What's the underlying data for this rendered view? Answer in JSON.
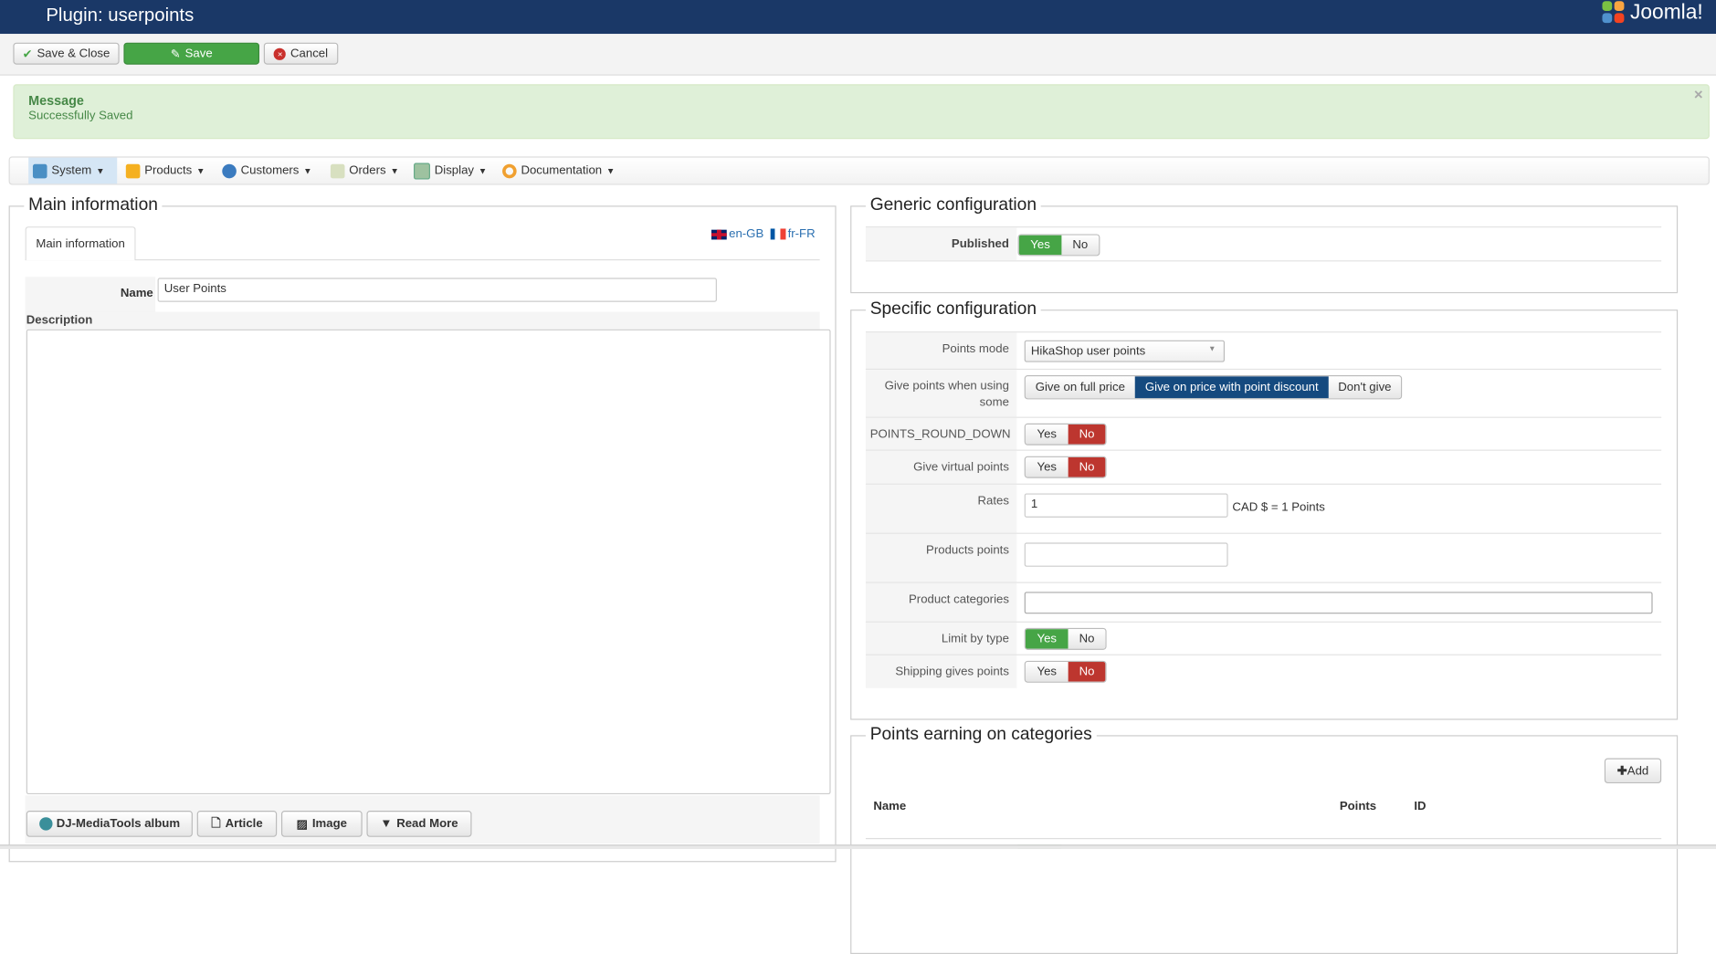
{
  "header": {
    "title": "Plugin: userpoints",
    "logo_text": "Joomla!"
  },
  "toolbar": {
    "save_close": "Save & Close",
    "save": "Save",
    "cancel": "Cancel"
  },
  "message": {
    "heading": "Message",
    "text": "Successfully Saved",
    "close": "×"
  },
  "menu": [
    {
      "label": "System"
    },
    {
      "label": "Products"
    },
    {
      "label": "Customers"
    },
    {
      "label": "Orders"
    },
    {
      "label": "Display"
    },
    {
      "label": "Documentation"
    }
  ],
  "main_info": {
    "legend": "Main information",
    "tab": "Main information",
    "lang_en": "en-GB",
    "lang_fr": "fr-FR",
    "name_label": "Name",
    "name_value": "User Points",
    "description_label": "Description",
    "editor_buttons": [
      "DJ-MediaTools album",
      "Article",
      "Image",
      "Read More"
    ]
  },
  "generic": {
    "legend": "Generic configuration",
    "published_label": "Published",
    "yes": "Yes",
    "no": "No"
  },
  "specific": {
    "legend": "Specific configuration",
    "points_mode_label": "Points mode",
    "points_mode_value": "HikaShop user points",
    "give_points_label": "Give points when using some",
    "give_options": [
      "Give on full price",
      "Give on price with point discount",
      "Don't give"
    ],
    "round_down_label": "POINTS_ROUND_DOWN",
    "virtual_label": "Give virtual points",
    "rates_label": "Rates",
    "rates_value": "1",
    "rates_suffix": "CAD $ = 1 Points",
    "products_points_label": "Products points",
    "product_categories_label": "Product categories",
    "limit_label": "Limit by type",
    "shipping_label": "Shipping gives points",
    "yes": "Yes",
    "no": "No"
  },
  "categories": {
    "legend": "Points earning on categories",
    "add": "Add",
    "col_name": "Name",
    "col_points": "Points",
    "col_id": "ID"
  },
  "colors": {
    "header": "#1a3867",
    "green": "#46a546",
    "red": "#bd362f",
    "blue": "#154a7f"
  }
}
